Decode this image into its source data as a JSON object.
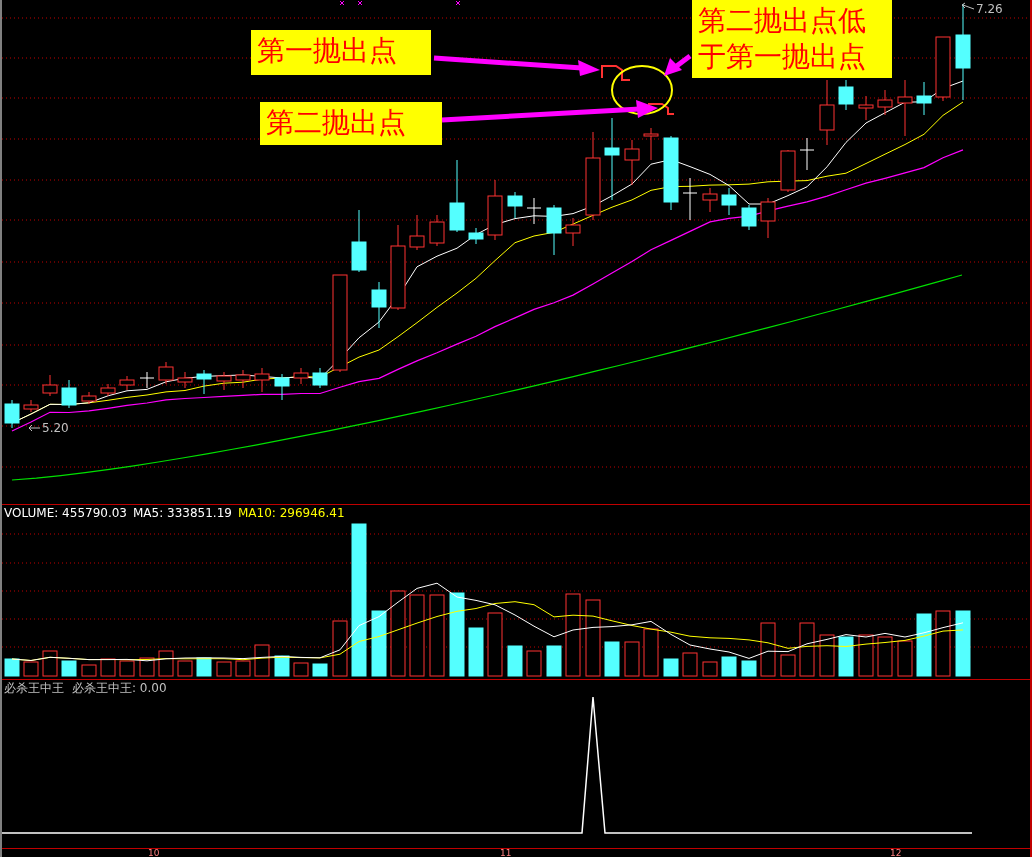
{
  "main_chart": {
    "price_labels": [
      {
        "kind": "low",
        "text": "5.20"
      },
      {
        "kind": "high",
        "text": "7.26"
      }
    ],
    "annotations": [
      {
        "text": "第一抛出点"
      },
      {
        "text": "第二抛出点"
      },
      {
        "text": "第二抛出点低于第一抛出点"
      }
    ]
  },
  "volume_panel": {
    "legend": [
      {
        "text": "VOLUME: 455790.03",
        "color": "#ffffff"
      },
      {
        "text": "MA5: 333851.19",
        "color": "#ffffff"
      },
      {
        "text": "MA10: 296946.41",
        "color": "#ffff00"
      }
    ]
  },
  "indicator_panel": {
    "legend": [
      "必杀王中王",
      "必杀王中王: 0.00"
    ]
  },
  "x_axis": {
    "labels": [
      "10",
      "11",
      "12"
    ]
  }
}
